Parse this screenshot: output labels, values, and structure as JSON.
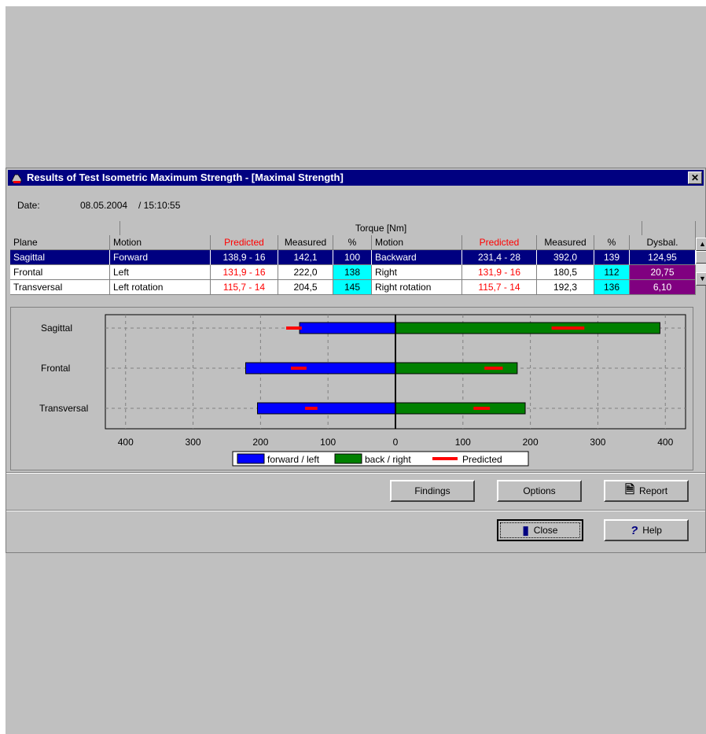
{
  "window": {
    "title": "Results of Test Isometric Maximum Strength - [Maximal Strength]",
    "close_icon": "close-icon",
    "app_icon": "app-icon"
  },
  "date": {
    "label": "Date:",
    "value": "08.05.2004",
    "time": "/ 15:10:55"
  },
  "table": {
    "group_header": "Torque [Nm]",
    "columns": [
      "Plane",
      "Motion",
      "Predicted",
      "Measured",
      "%",
      "Motion",
      "Predicted",
      "Measured",
      "%",
      "Dysbal."
    ],
    "rows": [
      [
        "Sagittal",
        "Forward",
        "138,9 - 16",
        "142,1",
        "100",
        "Backward",
        "231,4 - 28",
        "392,0",
        "139",
        "124,95"
      ],
      [
        "Frontal",
        "Left",
        "131,9 - 16",
        "222,0",
        "138",
        "Right",
        "131,9 - 16",
        "180,5",
        "112",
        "20,75"
      ],
      [
        "Transversal",
        "Left rotation",
        "115,7 - 14",
        "204,5",
        "145",
        "Right rotation",
        "115,7 - 14",
        "192,3",
        "136",
        "6,10"
      ]
    ],
    "colors": {
      "predicted": "#ff0000",
      "percent_bg": "#00ffff",
      "dysbal_bg": "#800080",
      "selected_bg": "#000080"
    }
  },
  "chart_data": {
    "type": "bar",
    "orientation": "horizontal-diverging",
    "categories": [
      "Sagittal",
      "Frontal",
      "Transversal"
    ],
    "x_ticks": [
      "400",
      "300",
      "200",
      "100",
      "0",
      "100",
      "200",
      "300",
      "400"
    ],
    "xlim": [
      -430,
      430
    ],
    "series": [
      {
        "name": "forward / left",
        "color": "#0000ff",
        "values": [
          142.1,
          222.0,
          204.5
        ]
      },
      {
        "name": "back / right",
        "color": "#008000",
        "values": [
          392.0,
          180.5,
          192.3
        ]
      }
    ],
    "predicted": {
      "name": "Predicted",
      "color": "#ff0000",
      "left": [
        [
          138.9,
          162
        ],
        [
          131.9,
          155
        ],
        [
          115.7,
          134
        ]
      ],
      "right": [
        [
          231.4,
          280
        ],
        [
          131.9,
          159
        ],
        [
          115.7,
          140
        ]
      ]
    },
    "grid": true,
    "legend_position": "bottom-center"
  },
  "buttons": {
    "findings": "Findings",
    "options": "Options",
    "report": "Report",
    "close": "Close",
    "help": "Help"
  }
}
